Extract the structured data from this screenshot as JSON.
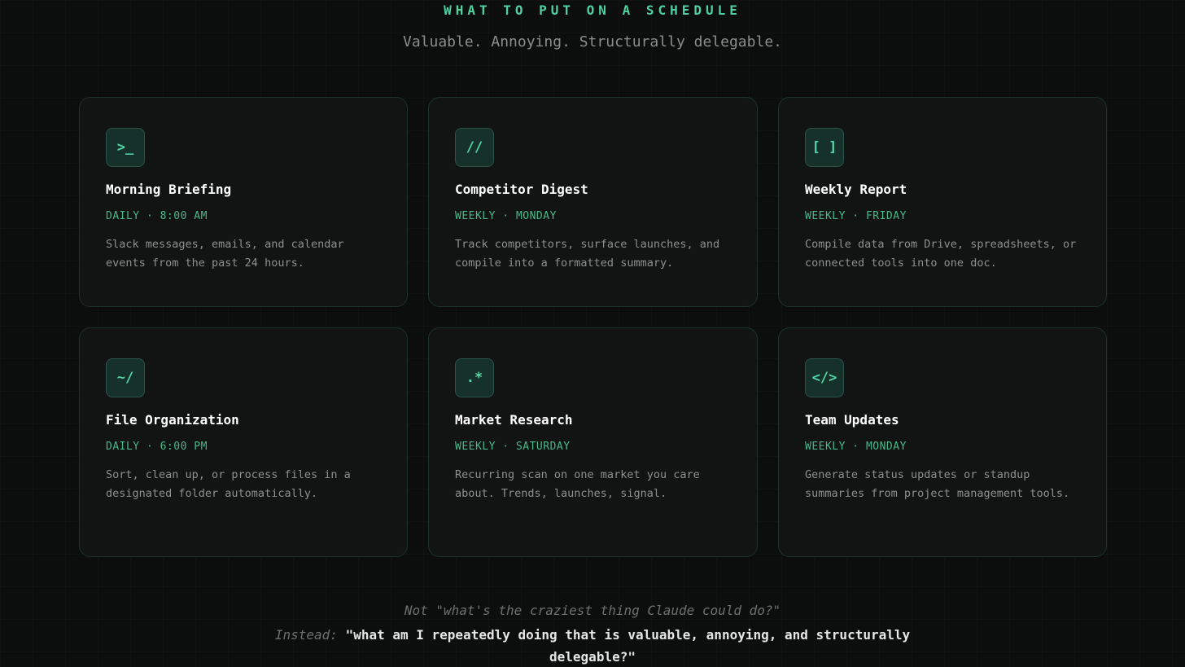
{
  "header": {
    "eyebrow": "WHAT TO PUT ON A SCHEDULE",
    "subtitle": "Valuable. Annoying. Structurally delegable."
  },
  "cards": [
    {
      "icon_glyph": ">_",
      "icon_name": "terminal-prompt-icon",
      "title": "Morning Briefing",
      "schedule": "DAILY · 8:00 AM",
      "description": "Slack messages, emails, and calendar events from the past 24 hours."
    },
    {
      "icon_glyph": "//",
      "icon_name": "double-slash-icon",
      "title": "Competitor Digest",
      "schedule": "WEEKLY · MONDAY",
      "description": "Track competitors, surface launches, and compile into a formatted summary."
    },
    {
      "icon_glyph": "[ ]",
      "icon_name": "brackets-icon",
      "title": "Weekly Report",
      "schedule": "WEEKLY · FRIDAY",
      "description": "Compile data from Drive, spreadsheets, or connected tools into one doc."
    },
    {
      "icon_glyph": "~/",
      "icon_name": "home-directory-icon",
      "title": "File Organization",
      "schedule": "DAILY · 6:00 PM",
      "description": "Sort, clean up, or process files in a designated folder automatically."
    },
    {
      "icon_glyph": ".*",
      "icon_name": "regex-wildcard-icon",
      "title": "Market Research",
      "schedule": "WEEKLY · SATURDAY",
      "description": "Recurring scan on one market you care about. Trends, launches, signal."
    },
    {
      "icon_glyph": "</>",
      "icon_name": "code-tag-icon",
      "title": "Team Updates",
      "schedule": "WEEKLY · MONDAY",
      "description": "Generate status updates or standup summaries from project management tools."
    }
  ],
  "footer": {
    "not_line": "Not \"what's the craziest thing Claude could do?\"",
    "instead_label": "Instead:",
    "instead_quote": "\"what am I repeatedly doing that is valuable, annoying, and structurally delegable?\""
  },
  "colors": {
    "accent": "#4fd1a1",
    "background": "#0c0d0d",
    "card_background": "#121313",
    "card_border": "#1d3329"
  }
}
